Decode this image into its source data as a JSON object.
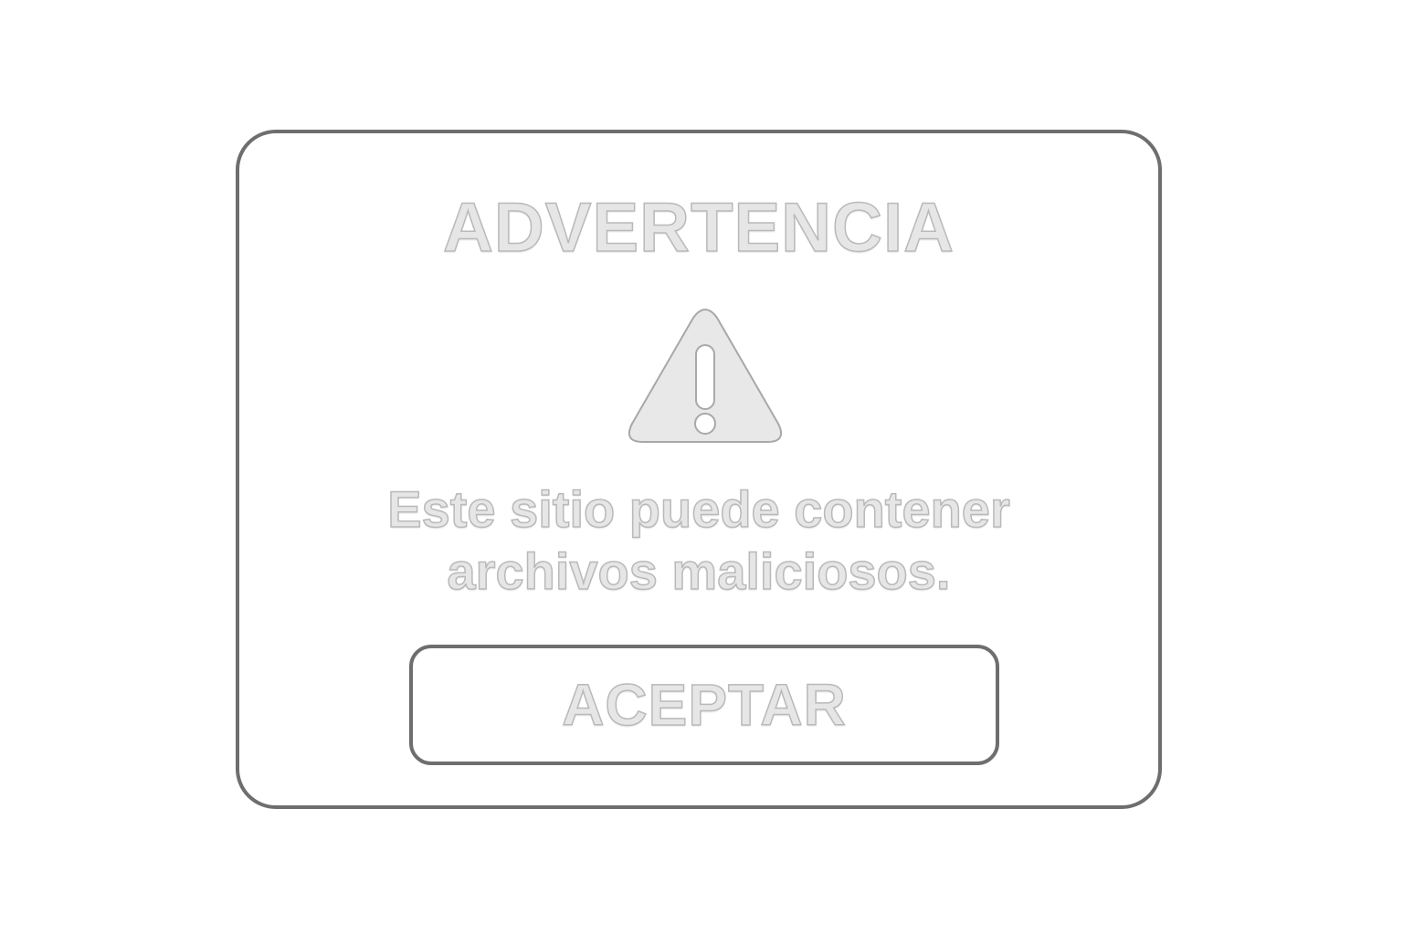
{
  "dialog": {
    "title": "ADVERTENCIA",
    "icon": "warning-triangle-icon",
    "message_line1": "Este sitio puede contener",
    "message_line2": "archivos maliciosos.",
    "button_label": "ACEPTAR"
  },
  "colors": {
    "border": "#6e6e6e",
    "text_fill": "#e6e6e6",
    "text_stroke": "#b9b9b9",
    "background": "#ffffff"
  }
}
